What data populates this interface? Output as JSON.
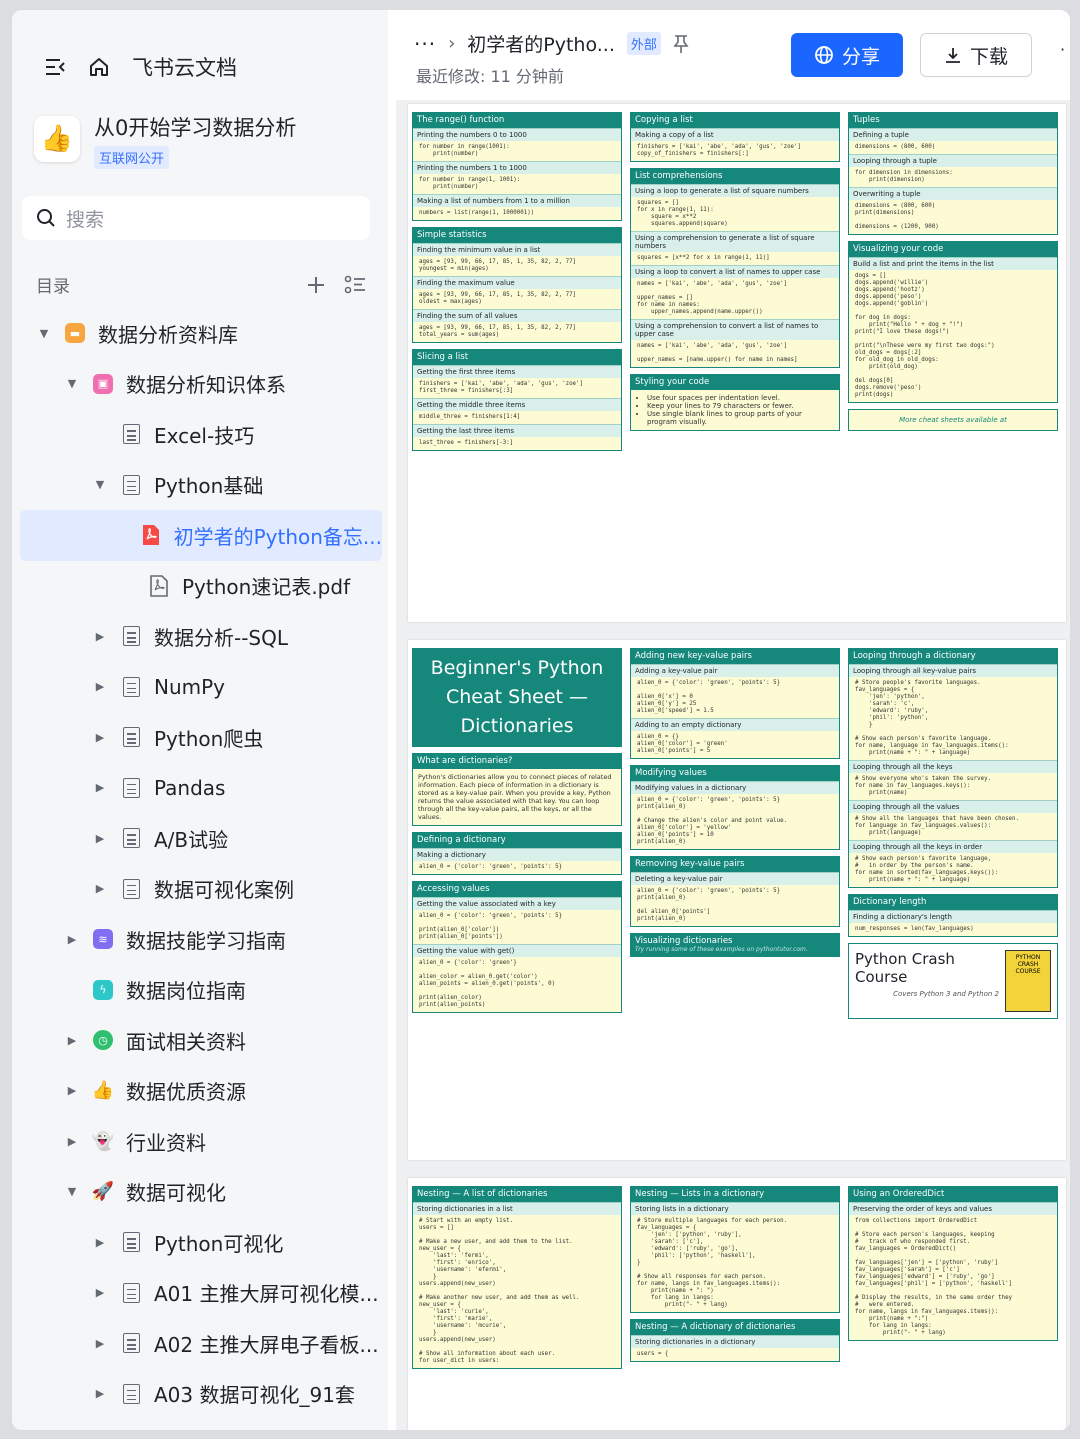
{
  "sidebar": {
    "brand": "飞书云文档",
    "workspace": {
      "title": "从0开始学习数据分析",
      "badge": "互联网公开"
    },
    "search_placeholder": "搜索",
    "toc_label": "目录",
    "tree": [
      {
        "label": "数据分析资料库",
        "level": 0,
        "toggle": "open",
        "icon": "folder-icon",
        "color": "#f7a541"
      },
      {
        "label": "数据分析知识体系",
        "level": 1,
        "toggle": "open",
        "icon": "mindmap-icon",
        "color": "#f06fb0"
      },
      {
        "label": "Excel-技巧",
        "level": 2,
        "toggle": "none",
        "icon": "doc-icon"
      },
      {
        "label": "Python基础",
        "level": 2,
        "toggle": "open",
        "icon": "doc-icon"
      },
      {
        "label": "初学者的Python备忘...",
        "level": 3,
        "toggle": "none",
        "icon": "pdf-icon",
        "selected": true
      },
      {
        "label": "Python速记表.pdf",
        "level": 3,
        "toggle": "none",
        "icon": "pdf-outline-icon"
      },
      {
        "label": "数据分析--SQL",
        "level": 2,
        "toggle": "closed",
        "icon": "doc-icon"
      },
      {
        "label": "NumPy",
        "level": 2,
        "toggle": "closed",
        "icon": "doc-icon"
      },
      {
        "label": "Python爬虫",
        "level": 2,
        "toggle": "closed",
        "icon": "doc-icon"
      },
      {
        "label": "Pandas",
        "level": 2,
        "toggle": "closed",
        "icon": "doc-icon"
      },
      {
        "label": "A/B试验",
        "level": 2,
        "toggle": "closed",
        "icon": "doc-icon"
      },
      {
        "label": "数据可视化案例",
        "level": 2,
        "toggle": "closed",
        "icon": "doc-icon"
      },
      {
        "label": "数据技能学习指南",
        "level": 1,
        "toggle": "closed",
        "icon": "layers-icon",
        "color": "#7f6df2"
      },
      {
        "label": "数据岗位指南",
        "level": 1,
        "toggle": "none",
        "icon": "bolt-icon",
        "color": "#2ec7c9"
      },
      {
        "label": "面试相关资料",
        "level": 1,
        "toggle": "closed",
        "icon": "clock-icon",
        "color": "#2fbf71"
      },
      {
        "label": "数据优质资源",
        "level": 1,
        "toggle": "closed",
        "icon": "thumbs-up-icon",
        "color": "#f7b500"
      },
      {
        "label": "行业资料",
        "level": 1,
        "toggle": "closed",
        "icon": "ghost-icon",
        "color": "#f0a0c8"
      },
      {
        "label": "数据可视化",
        "level": 1,
        "toggle": "open",
        "icon": "rocket-icon",
        "color": "#e8483f"
      },
      {
        "label": "Python可视化",
        "level": 2,
        "toggle": "closed",
        "icon": "doc-icon"
      },
      {
        "label": "A01 主推大屏可视化模...",
        "level": 2,
        "toggle": "closed",
        "icon": "doc-icon"
      },
      {
        "label": "A02 主推大屏电子看板...",
        "level": 2,
        "toggle": "closed",
        "icon": "doc-icon"
      },
      {
        "label": "A03 数据可视化_91套",
        "level": 2,
        "toggle": "closed",
        "icon": "doc-icon"
      }
    ]
  },
  "header": {
    "title": "初学者的Pytho...",
    "tag": "外部",
    "modified": "最近修改: 11 分钟前",
    "share_label": "分享",
    "download_label": "下载"
  },
  "pdf": {
    "page1": {
      "col1": [
        {
          "title": "The range() function",
          "rows": [
            [
              "Printing the numbers 0 to 1000",
              "for number in range(1001):\n    print(number)"
            ],
            [
              "Printing the numbers 1 to 1000",
              "for number in range(1, 1001):\n    print(number)"
            ],
            [
              "Making a list of numbers from 1 to a million",
              "numbers = list(range(1, 1000001))"
            ]
          ]
        },
        {
          "title": "Simple statistics",
          "rows": [
            [
              "Finding the minimum value in a list",
              "ages = [93, 99, 66, 17, 85, 1, 35, 82, 2, 77]\nyoungest = min(ages)"
            ],
            [
              "Finding the maximum value",
              "ages = [93, 99, 66, 17, 85, 1, 35, 82, 2, 77]\noldest = max(ages)"
            ],
            [
              "Finding the sum of all values",
              "ages = [93, 99, 66, 17, 85, 1, 35, 82, 2, 77]\ntotal_years = sum(ages)"
            ]
          ]
        },
        {
          "title": "Slicing a list",
          "rows": [
            [
              "Getting the first three items",
              "finishers = ['kai', 'abe', 'ada', 'gus', 'zoe']\nfirst_three = finishers[:3]"
            ],
            [
              "Getting the middle three items",
              "middle_three = finishers[1:4]"
            ],
            [
              "Getting the last three items",
              "last_three = finishers[-3:]"
            ]
          ]
        }
      ],
      "col2": [
        {
          "title": "Copying a list",
          "rows": [
            [
              "Making a copy of a list",
              "finishers = ['kai', 'abe', 'ada', 'gus', 'zoe']\ncopy_of_finishers = finishers[:]"
            ]
          ]
        },
        {
          "title": "List comprehensions",
          "rows": [
            [
              "Using a loop to generate a list of square numbers",
              "squares = []\nfor x in range(1, 11):\n    square = x**2\n    squares.append(square)"
            ],
            [
              "Using a comprehension to generate a list of square numbers",
              "squares = [x**2 for x in range(1, 11)]"
            ],
            [
              "Using a loop to convert a list of names to upper case",
              "names = ['kai', 'abe', 'ada', 'gus', 'zoe']\n\nupper_names = []\nfor name in names:\n    upper_names.append(name.upper())"
            ],
            [
              "Using a comprehension to convert a list of names to upper case",
              "names = ['kai', 'abe', 'ada', 'gus', 'zoe']\n\nupper_names = [name.upper() for name in names]"
            ]
          ]
        },
        {
          "title": "Styling your code",
          "bullets": [
            "Use four spaces per indentation level.",
            "Keep your lines to 79 characters or fewer.",
            "Use single blank lines to group parts of your program visually."
          ]
        }
      ],
      "col3": [
        {
          "title": "Tuples",
          "rows": [
            [
              "Defining a tuple",
              "dimensions = (800, 600)"
            ],
            [
              "Looping through a tuple",
              "for dimension in dimensions:\n    print(dimension)"
            ],
            [
              "Overwriting a tuple",
              "dimensions = (800, 600)\nprint(dimensions)\n\ndimensions = (1200, 900)"
            ]
          ]
        },
        {
          "title": "Visualizing your code",
          "rows": [
            [
              "Build a list and print the items in the list",
              "dogs = []\ndogs.append('willie')\ndogs.append('hootz')\ndogs.append('peso')\ndogs.append('goblin')\n\nfor dog in dogs:\n    print(\"Hello \" + dog + \"!\")\nprint(\"I love these dogs!\")\n\nprint(\"\\nThese were my first two dogs:\")\nold_dogs = dogs[:2]\nfor old_dog in old_dogs:\n    print(old_dog)\n\ndel dogs[0]\ndogs.remove('peso')\nprint(dogs)"
            ]
          ]
        }
      ],
      "more_note": "More cheat sheets available at"
    },
    "page2": {
      "big_title": "Beginner's Python Cheat Sheet — Dictionaries",
      "col1": [
        {
          "title": "What are dictionaries?",
          "para": "Python's dictionaries allow you to connect pieces of related information. Each piece of information in a dictionary is stored as a key-value pair. When you provide a key, Python returns the value associated with that key. You can loop through all the key-value pairs, all the keys, or all the values."
        },
        {
          "title": "Defining a dictionary",
          "rows": [
            [
              "Making a dictionary",
              "alien_0 = {'color': 'green', 'points': 5}"
            ]
          ]
        },
        {
          "title": "Accessing values",
          "rows": [
            [
              "Getting the value associated with a key",
              "alien_0 = {'color': 'green', 'points': 5}\n\nprint(alien_0['color'])\nprint(alien_0['points'])"
            ],
            [
              "Getting the value with get()",
              "alien_0 = {'color': 'green'}\n\nalien_color = alien_0.get('color')\nalien_points = alien_0.get('points', 0)\n\nprint(alien_color)\nprint(alien_points)"
            ]
          ]
        }
      ],
      "col2": [
        {
          "title": "Adding new key-value pairs",
          "rows": [
            [
              "Adding a key-value pair",
              "alien_0 = {'color': 'green', 'points': 5}\n\nalien_0['x'] = 0\nalien_0['y'] = 25\nalien_0['speed'] = 1.5"
            ],
            [
              "Adding to an empty dictionary",
              "alien_0 = {}\nalien_0['color'] = 'green'\nalien_0['points'] = 5"
            ]
          ]
        },
        {
          "title": "Modifying values",
          "rows": [
            [
              "Modifying values in a dictionary",
              "alien_0 = {'color': 'green', 'points': 5}\nprint(alien_0)\n\n# Change the alien's color and point value.\nalien_0['color'] = 'yellow'\nalien_0['points'] = 10\nprint(alien_0)"
            ]
          ]
        },
        {
          "title": "Removing key-value pairs",
          "rows": [
            [
              "Deleting a key-value pair",
              "alien_0 = {'color': 'green', 'points': 5}\nprint(alien_0)\n\ndel alien_0['points']\nprint(alien_0)"
            ]
          ]
        },
        {
          "title": "Visualizing dictionaries",
          "sub": "Try running some of these examples on pythontutor.com."
        }
      ],
      "col3": [
        {
          "title": "Looping through a dictionary",
          "rows": [
            [
              "Looping through all key-value pairs",
              "# Store people's favorite languages.\nfav_languages = {\n    'jen': 'python',\n    'sarah': 'c',\n    'edward': 'ruby',\n    'phil': 'python',\n    }\n\n# Show each person's favorite language.\nfor name, language in fav_languages.items():\n    print(name + \": \" + language)"
            ],
            [
              "Looping through all the keys",
              "# Show everyone who's taken the survey.\nfor name in fav_languages.keys():\n    print(name)"
            ],
            [
              "Looping through all the values",
              "# Show all the languages that have been chosen.\nfor language in fav_languages.values():\n    print(language)"
            ],
            [
              "Looping through all the keys in order",
              "# Show each person's favorite language,\n#   in order by the person's name.\nfor name in sorted(fav_languages.keys()):\n    print(name + \": \" + language)"
            ]
          ]
        },
        {
          "title": "Dictionary length",
          "rows": [
            [
              "Finding a dictionary's length",
              "num_responses = len(fav_languages)"
            ]
          ]
        }
      ],
      "book": {
        "title": "Python Crash Course",
        "subtitle": "Covers Python 3 and Python 2",
        "cover": "PYTHON CRASH COURSE"
      }
    },
    "page3": {
      "col1": [
        {
          "title": "Nesting — A list of dictionaries",
          "rows": [
            [
              "Storing dictionaries in a list",
              "# Start with an empty list.\nusers = []\n\n# Make a new user, and add them to the list.\nnew_user = {\n    'last': 'fermi',\n    'first': 'enrico',\n    'username': 'efermi',\n    }\nusers.append(new_user)\n\n# Make another new user, and add them as well.\nnew_user = {\n    'last': 'curie',\n    'first': 'marie',\n    'username': 'mcurie',\n    }\nusers.append(new_user)\n\n# Show all information about each user.\nfor user_dict in users:"
            ]
          ]
        }
      ],
      "col2": [
        {
          "title": "Nesting — Lists in a dictionary",
          "rows": [
            [
              "Storing lists in a dictionary",
              "# Store multiple languages for each person.\nfav_languages = {\n    'jen': ['python', 'ruby'],\n    'sarah': ['c'],\n    'edward': ['ruby', 'go'],\n    'phil': ['python', 'haskell'],\n}\n\n# Show all responses for each person.\nfor name, langs in fav_languages.items():\n    print(name + \": \")\n    for lang in langs:\n        print(\"- \" + lang)"
            ]
          ]
        },
        {
          "title": "Nesting — A dictionary of dictionaries",
          "rows": [
            [
              "Storing dictionaries in a dictionary",
              "users = {"
            ]
          ]
        }
      ],
      "col3": [
        {
          "title": "Using an OrderedDict",
          "rows": [
            [
              "Preserving the order of keys and values",
              "from collections import OrderedDict\n\n# Store each person's languages, keeping\n#   track of who responded first.\nfav_languages = OrderedDict()\n\nfav_languages['jen'] = ['python', 'ruby']\nfav_languages['sarah'] = ['c']\nfav_languages['edward'] = ['ruby', 'go']\nfav_languages['phil'] = ['python', 'haskell']\n\n# Display the results, in the same order they\n#   were entered.\nfor name, langs in fav_languages.items():\n    print(name + \":\")\n    for lang in langs:\n        print(\"- \" + lang)"
            ]
          ]
        }
      ]
    }
  }
}
